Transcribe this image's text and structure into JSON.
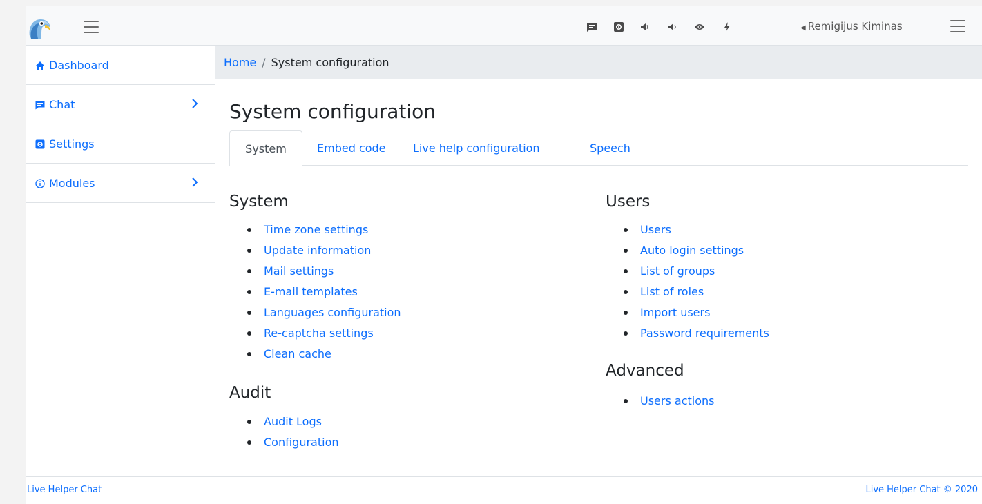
{
  "header": {
    "username": "Remigijus Kiminas",
    "icons": [
      "chat-icon",
      "settings-icon",
      "sound-icon",
      "sound-icon",
      "eye-icon",
      "flash-icon"
    ]
  },
  "sidebar": {
    "items": [
      {
        "label": "Dashboard",
        "icon": "home-icon",
        "has_submenu": false
      },
      {
        "label": "Chat",
        "icon": "chat-icon",
        "has_submenu": true
      },
      {
        "label": "Settings",
        "icon": "settings-icon",
        "has_submenu": false
      },
      {
        "label": "Modules",
        "icon": "info-icon",
        "has_submenu": true
      }
    ]
  },
  "breadcrumb": {
    "home": "Home",
    "separator": "/",
    "current": "System configuration"
  },
  "main": {
    "title": "System configuration",
    "tabs": [
      {
        "label": "System",
        "active": true
      },
      {
        "label": "Embed code",
        "active": false
      },
      {
        "label": "Live help configuration",
        "active": false
      },
      {
        "label": "Speech",
        "active": false
      }
    ],
    "sections": {
      "system": {
        "heading": "System",
        "links": [
          "Time zone settings",
          "Update information",
          "Mail settings",
          "E-mail templates",
          "Languages configuration",
          "Re-captcha settings",
          "Clean cache"
        ]
      },
      "audit": {
        "heading": "Audit",
        "links": [
          "Audit Logs",
          "Configuration"
        ]
      },
      "users": {
        "heading": "Users",
        "links": [
          "Users",
          "Auto login settings",
          "List of groups",
          "List of roles",
          "Import users",
          "Password requirements"
        ]
      },
      "advanced": {
        "heading": "Advanced",
        "links": [
          "Users actions"
        ]
      }
    }
  },
  "footer": {
    "left": "Live Helper Chat",
    "right": "Live Helper Chat © 2020"
  },
  "colors": {
    "link": "#0d6efd",
    "breadcrumb_bg": "#e9ecef",
    "topbar_bg": "#f8f9fa",
    "border": "#dee2e6"
  }
}
